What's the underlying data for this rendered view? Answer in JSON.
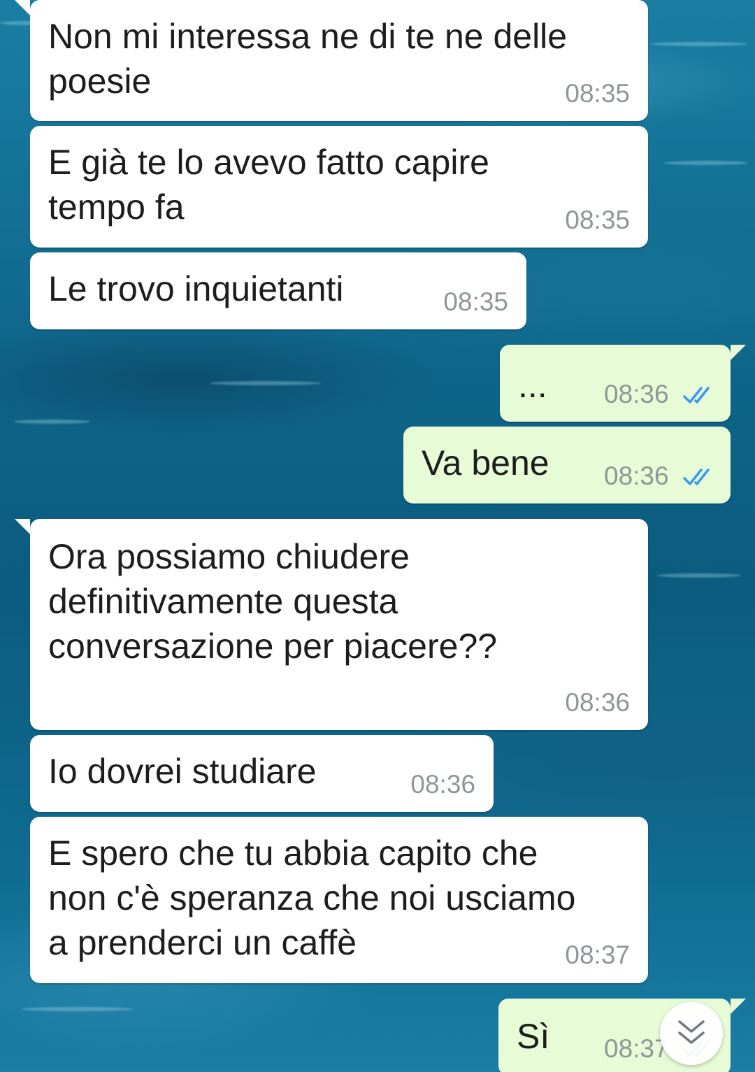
{
  "messages": [
    {
      "direction": "in",
      "text": "Non mi interessa ne di te ne delle\npoesie",
      "time": "08:35"
    },
    {
      "direction": "in",
      "text": "E già te lo avevo fatto capire\ntempo fa",
      "time": "08:35"
    },
    {
      "direction": "in",
      "text": "Le trovo inquietanti",
      "time": "08:35"
    },
    {
      "direction": "out",
      "text": "...",
      "time": "08:36",
      "status": "read"
    },
    {
      "direction": "out",
      "text": "Va bene",
      "time": "08:36",
      "status": "read"
    },
    {
      "direction": "in",
      "text": "Ora possiamo chiudere\ndefinitivamente questa\nconversazione per piacere??",
      "time": "08:36"
    },
    {
      "direction": "in",
      "text": "Io dovrei studiare",
      "time": "08:36"
    },
    {
      "direction": "in",
      "text": "E spero che tu abbia capito che\nnon c'è speranza che noi usciamo\na prenderci un caffè",
      "time": "08:37"
    },
    {
      "direction": "out",
      "text": "Sì",
      "time": "08:37",
      "status": "read"
    }
  ],
  "colors": {
    "incoming_bubble": "#ffffff",
    "outgoing_bubble": "#e7fcd6",
    "read_check": "#3a98f0",
    "timestamp": "#8f9796"
  },
  "icons": {
    "read_receipt": "double-check-icon",
    "scroll_down": "double-chevron-down-icon"
  }
}
